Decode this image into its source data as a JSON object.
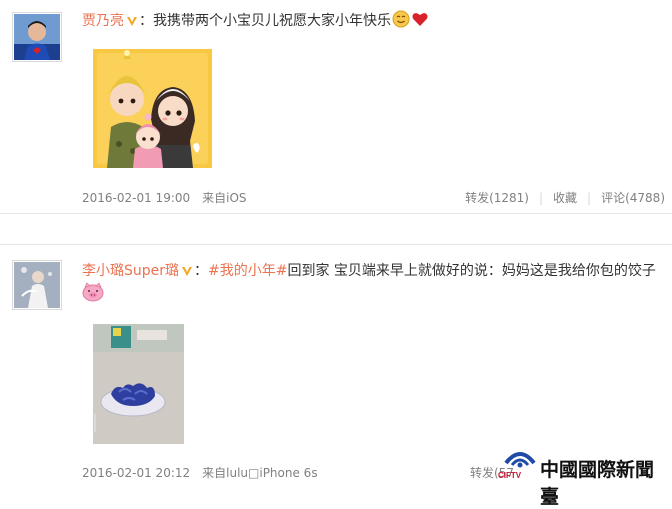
{
  "posts": [
    {
      "username": "贾乃亮",
      "colon": "：",
      "topic": "",
      "text": "我携带两个小宝贝儿祝愿大家小年快乐",
      "emoji_1": "smile-emoji-icon",
      "emoji_2": "heart-emoji-icon",
      "timestamp": "2016-02-01 19:00",
      "source": "来自iOS",
      "repost_label": "转发(1281)",
      "favorite_label": "收藏",
      "comment_label": "评论(4788)"
    },
    {
      "username": "李小璐Super璐",
      "colon": "：",
      "topic": "#我的小年#",
      "text": "回到家 宝贝端来早上就做好的说：妈妈这是我给你包的饺子",
      "emoji_1": "pig-emoji-icon",
      "timestamp": "2016-02-01 20:12",
      "source": "来自lulu□iPhone 6s",
      "repost_label": "转发(57"
    }
  ],
  "watermark": {
    "name": "中國國際新聞臺",
    "abbr": "CIFTV"
  },
  "colors": {
    "username": "#eb7350",
    "meta": "#808080",
    "vip": "#f5a623",
    "divider": "#e6e6e6"
  }
}
